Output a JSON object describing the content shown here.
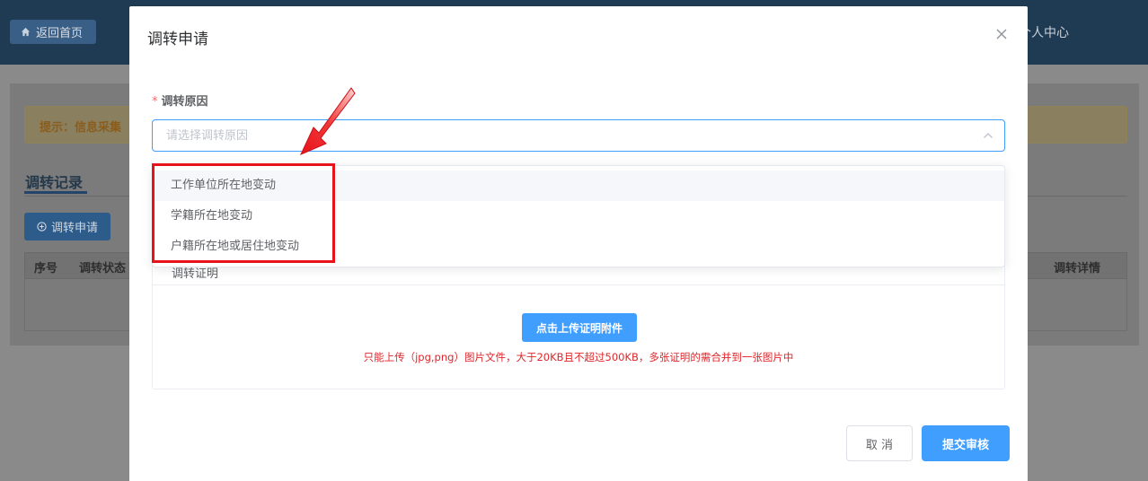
{
  "background": {
    "home_button": "返回首页",
    "user_center": "个人中心",
    "tip": "提示：信息采集",
    "tab": "调转记录",
    "apply_button": "调转申请",
    "table_headers": [
      "序号",
      "调转状态",
      "调转详情"
    ]
  },
  "modal": {
    "title": "调转申请",
    "reason_label": "调转原因",
    "reason_placeholder": "请选择调转原因",
    "reason_options": [
      "工作单位所在地变动",
      "学籍所在地变动",
      "户籍所在地或居住地变动"
    ],
    "proof_label": "调转证明",
    "upload_button": "点击上传证明附件",
    "upload_hint": "只能上传（jpg,png）图片文件，大于20KB且不超过500KB，多张证明的需合并到一张图片中",
    "cancel_button": "取 消",
    "submit_button": "提交审核"
  },
  "colors": {
    "primary": "#409eff",
    "annotation_red": "#e8131a",
    "hint_red": "#e0262a",
    "header_dark": "#1f3b54"
  }
}
